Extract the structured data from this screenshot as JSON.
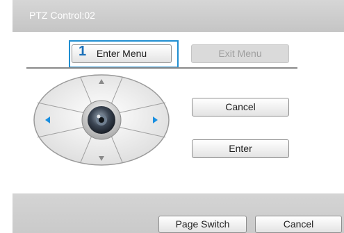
{
  "dialog": {
    "title": "PTZ Control:02",
    "enter_menu_label": "Enter Menu",
    "exit_menu_label": "Exit Menu",
    "cancel_label": "Cancel",
    "enter_label": "Enter",
    "highlight_number": "1"
  },
  "footer": {
    "page_switch_label": "Page Switch",
    "cancel_label": "Cancel"
  },
  "colors": {
    "highlight": "#1f8ed1",
    "arrow_active": "#1a8fe0",
    "arrow_inactive": "#8a8a8a"
  },
  "icons": {
    "center": "camera-lens-icon",
    "up": "arrow-up-icon",
    "down": "arrow-down-icon",
    "left": "arrow-left-icon",
    "right": "arrow-right-icon"
  }
}
